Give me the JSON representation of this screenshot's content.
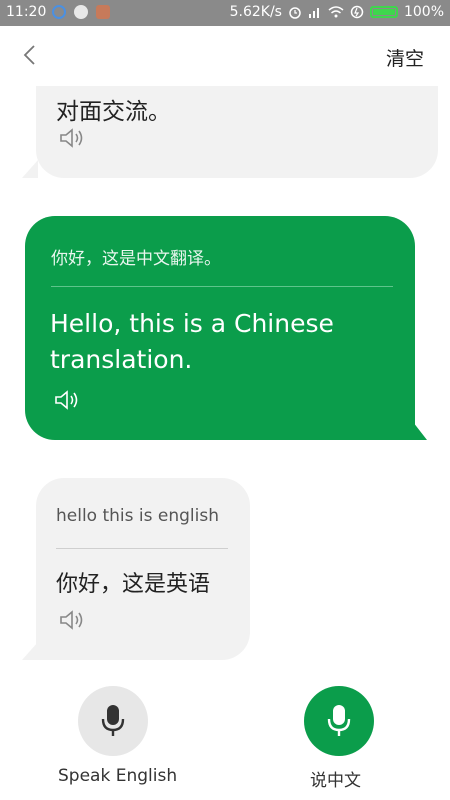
{
  "status_bar": {
    "time": "11:20",
    "network_speed": "5.62K/s",
    "battery": "100%"
  },
  "header": {
    "clear_label": "清空"
  },
  "messages": [
    {
      "text": "对面交流。"
    },
    {
      "source": "你好，这是中文翻译。",
      "translation": "Hello, this is a Chinese translation."
    },
    {
      "source": "hello this is english",
      "translation": "你好，这是英语"
    }
  ],
  "controls": {
    "english_label": "Speak English",
    "chinese_label": "说中文"
  },
  "colors": {
    "accent": "#0b9d4b",
    "bubble_gray": "#f2f2f2"
  }
}
